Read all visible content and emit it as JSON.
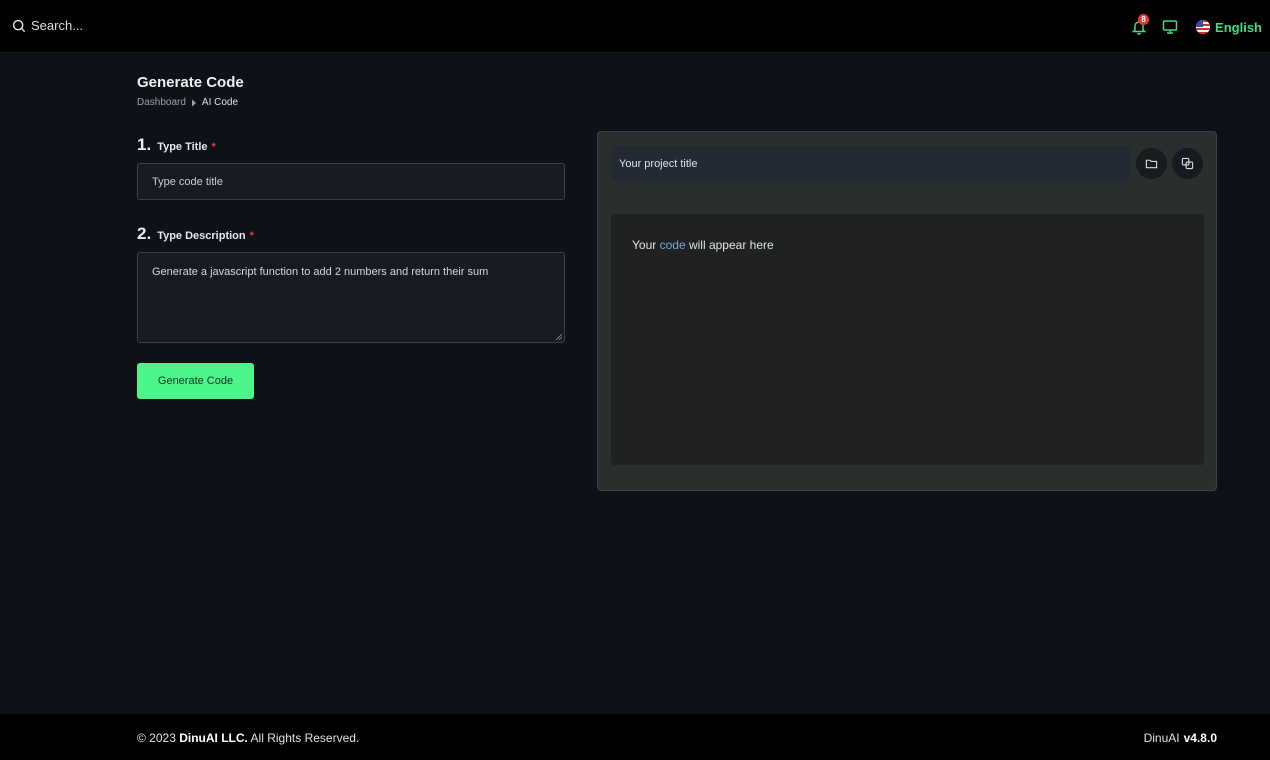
{
  "header": {
    "search_placeholder": "Search...",
    "notification_count": "8",
    "language": "English",
    "icons": [
      "search-icon",
      "bell-icon",
      "monitor-icon",
      "us-flag-icon"
    ]
  },
  "page": {
    "title": "Generate Code",
    "breadcrumb": [
      "Dashboard",
      "AI Code"
    ]
  },
  "form": {
    "step1": {
      "number": "1.",
      "label": "Type Title",
      "required_mark": "*",
      "placeholder": "Type code title"
    },
    "step2": {
      "number": "2.",
      "label": "Type Description",
      "required_mark": "*",
      "value": "Generate a javascript function to add 2 numbers and return their sum"
    },
    "submit_label": "Generate Code"
  },
  "preview": {
    "project_title_placeholder": "Your project title",
    "message_prefix": "Your ",
    "message_highlight": "code",
    "message_suffix": " will appear here"
  },
  "footer": {
    "copyright_prefix": "© 2023 ",
    "company": "DinuAI LLC.",
    "copyright_suffix": " All Rights Reserved.",
    "product": "DinuAI",
    "version": "v4.8.0"
  },
  "colors": {
    "accent": "#4cf58a",
    "lang_text": "#3ddc84",
    "badge": "#e53935",
    "background": "#0e1118"
  }
}
